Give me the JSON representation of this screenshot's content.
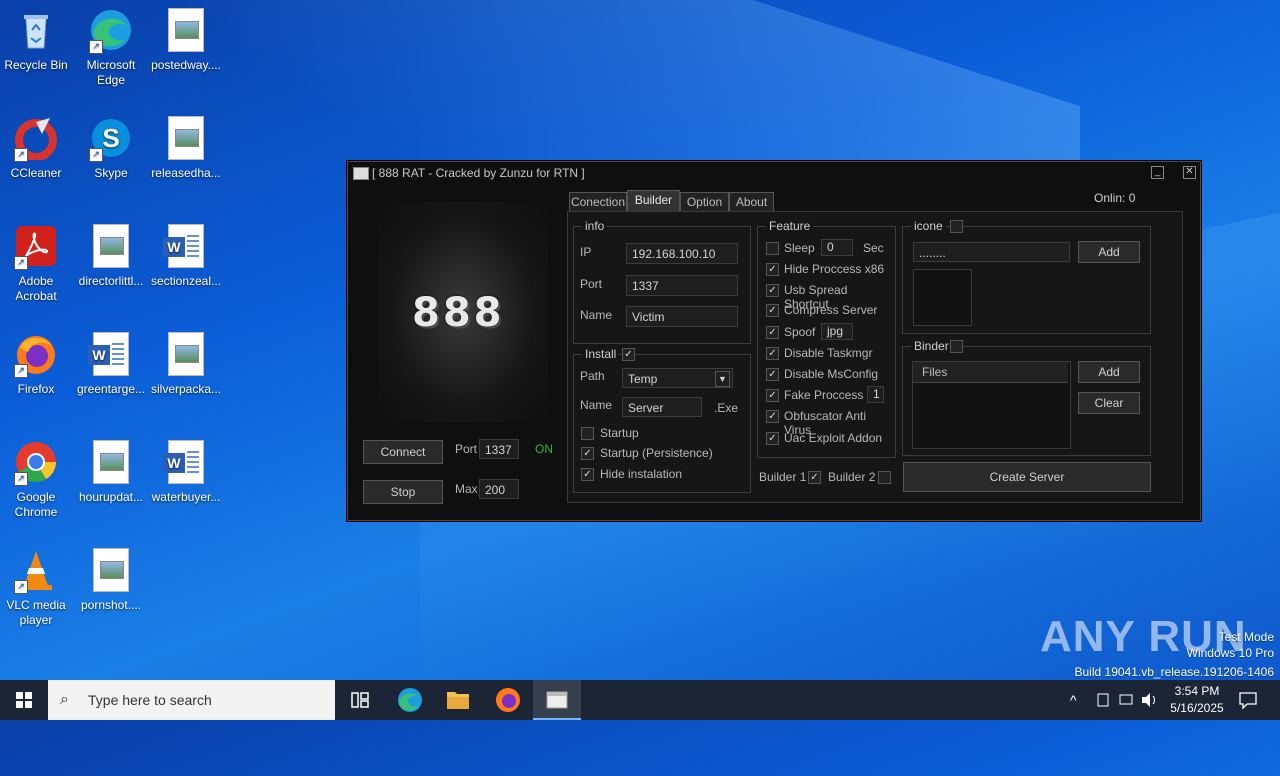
{
  "desktop": {
    "icons": [
      {
        "label": "Recycle Bin"
      },
      {
        "label": "Microsoft Edge"
      },
      {
        "label": "postedway...."
      },
      {
        "label": "CCleaner"
      },
      {
        "label": "Skype"
      },
      {
        "label": "releasedha..."
      },
      {
        "label": "Adobe Acrobat"
      },
      {
        "label": "directorlittl..."
      },
      {
        "label": "sectionzeal..."
      },
      {
        "label": "Firefox"
      },
      {
        "label": "greentarge..."
      },
      {
        "label": "silverpacka..."
      },
      {
        "label": "Google Chrome"
      },
      {
        "label": "hourupdat..."
      },
      {
        "label": "waterbuyer..."
      },
      {
        "label": "VLC media player"
      },
      {
        "label": "pornshot...."
      }
    ]
  },
  "rat_window": {
    "title": "[ 888 RAT - Cracked by Zunzu for RTN ]",
    "logo_text": "888",
    "online_label": "Onlin:",
    "online_count": "0",
    "connect_label": "Connect",
    "stop_label": "Stop",
    "port_label": "Port",
    "port_value": "1337",
    "status": "ON",
    "max_label": "Max",
    "max_value": "200",
    "tabs": [
      "Conection",
      "Builder",
      "Option",
      "About"
    ],
    "info": {
      "title": "info",
      "ip_label": "IP",
      "ip_value": "192.168.100.10",
      "port_label": "Port",
      "port_value": "1337",
      "name_label": "Name",
      "name_value": "Victim"
    },
    "install": {
      "title": "Install",
      "path_label": "Path",
      "path_value": "Temp",
      "name_label": "Name",
      "name_value": "Server",
      "ext": ".Exe",
      "startup": "Startup",
      "startup_persistence": "Startup (Persistence)",
      "hide_install": "Hide instalation"
    },
    "feature": {
      "title": "Feature",
      "sleep": "Sleep",
      "sleep_value": "0",
      "sec": "Sec",
      "items": [
        "Hide Proccess x86",
        "Usb Spread Shortcut",
        "Compress Server"
      ],
      "spoof": "Spoof",
      "spoof_value": "jpg",
      "items2": [
        "Disable Taskmgr",
        "Disable MsConfig"
      ],
      "fake_process": "Fake Proccess",
      "fake_value": "1",
      "items3": [
        "Obfuscator Anti Virus",
        "Uac Exploit Addon"
      ]
    },
    "builder1": "Builder 1",
    "builder2": "Builder 2",
    "icone": {
      "title": "icone",
      "path_value": "........",
      "add_label": "Add"
    },
    "binder": {
      "title": "Binder",
      "files_header": "Files",
      "add_label": "Add",
      "clear_label": "Clear"
    },
    "create_server": "Create Server"
  },
  "watermark": {
    "brand": "ANY RUN",
    "line1": "Test Mode",
    "line2": "Windows 10 Pro",
    "line3": "Build 19041.vb_release.191206-1406"
  },
  "taskbar": {
    "search_placeholder": "Type here to search",
    "time": "3:54 PM",
    "date": "5/16/2025"
  },
  "colors": {
    "status_on": "#2db82d",
    "taskbar": "#1b2535",
    "window_bg": "#0f0f0f"
  }
}
